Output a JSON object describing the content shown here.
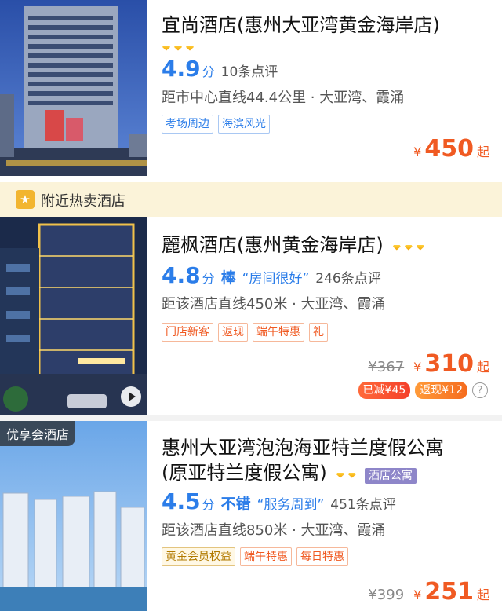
{
  "section": {
    "label": "附近热卖酒店",
    "icon": "star-badge-icon"
  },
  "hotels": [
    {
      "name": "宜尚酒店(惠州大亚湾黄金海岸店)",
      "diamonds": 3,
      "score": "4.9",
      "score_unit": "分",
      "reviews": "10条点评",
      "distance": "距市中心直线44.4公里 · 大亚湾、霞涌",
      "tags": [
        "考场周边",
        "海滨风光"
      ],
      "price_symbol": "¥",
      "price": "450",
      "price_suffix": "起"
    },
    {
      "name": "麗枫酒店(惠州黄金海岸店)",
      "diamonds": 3,
      "score": "4.8",
      "score_unit": "分",
      "level": "棒",
      "quote": "“房间很好”",
      "reviews": "246条点评",
      "distance": "距该酒店直线450米 · 大亚湾、霞涌",
      "tags": [
        "门店新客",
        "返现",
        "端午特惠",
        "礼"
      ],
      "original_price": "¥367",
      "price_symbol": "¥",
      "price": "310",
      "price_suffix": "起",
      "discounts": [
        "已减¥45",
        "返现¥12"
      ],
      "help_icon": "?",
      "has_video": true
    },
    {
      "name_line1": "惠州大亚湾泡泡海亚特兰度假公寓",
      "name_line2": "(原亚特兰度假公寓)",
      "diamonds": 2,
      "type_badge": "酒店公寓",
      "thumb_badge": "优享会酒店",
      "score": "4.5",
      "score_unit": "分",
      "level": "不错",
      "quote": "“服务周到”",
      "reviews": "451条点评",
      "distance": "距该酒店直线850米 · 大亚湾、霞涌",
      "tags": [
        "黄金会员权益",
        "端午特惠",
        "每日特惠"
      ],
      "original_price": "¥399",
      "price_symbol": "¥",
      "price": "251",
      "price_suffix": "起"
    }
  ],
  "colors": {
    "accent_blue": "#2b7de9",
    "price_orange": "#f05a22",
    "section_bg": "#fbf3d9"
  }
}
